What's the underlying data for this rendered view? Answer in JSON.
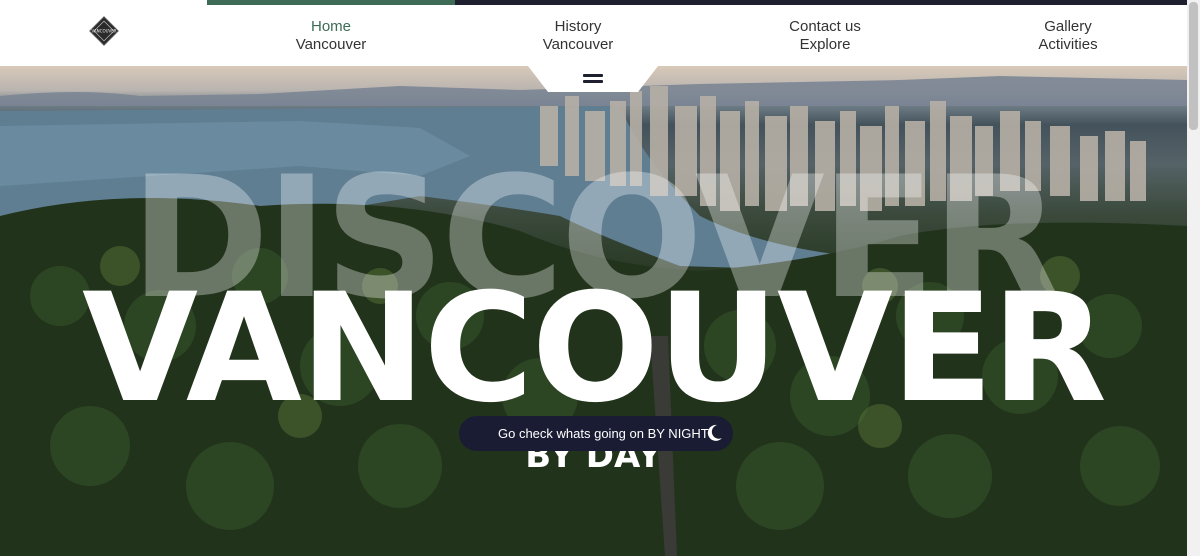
{
  "nav": {
    "logo_text": "VANCOUVER",
    "items": [
      {
        "line1": "Home",
        "line2": "Vancouver"
      },
      {
        "line1": "History",
        "line2": "Vancouver"
      },
      {
        "line1": "Contact us",
        "line2": "Explore"
      },
      {
        "line1": "Gallery",
        "line2": "Activities"
      }
    ],
    "active_color": "#3d6b55"
  },
  "hero": {
    "title_back": "DISCOVER",
    "title_main": "VANCOUVER",
    "subtitle": "BY DAY",
    "night_button": "Go check whats going on BY NIGHT",
    "menu_icon": "hamburger-icon",
    "moon_icon": "moon-icon"
  },
  "colors": {
    "accent_green": "#3d6b55",
    "dark_navy": "#1a1c33"
  }
}
